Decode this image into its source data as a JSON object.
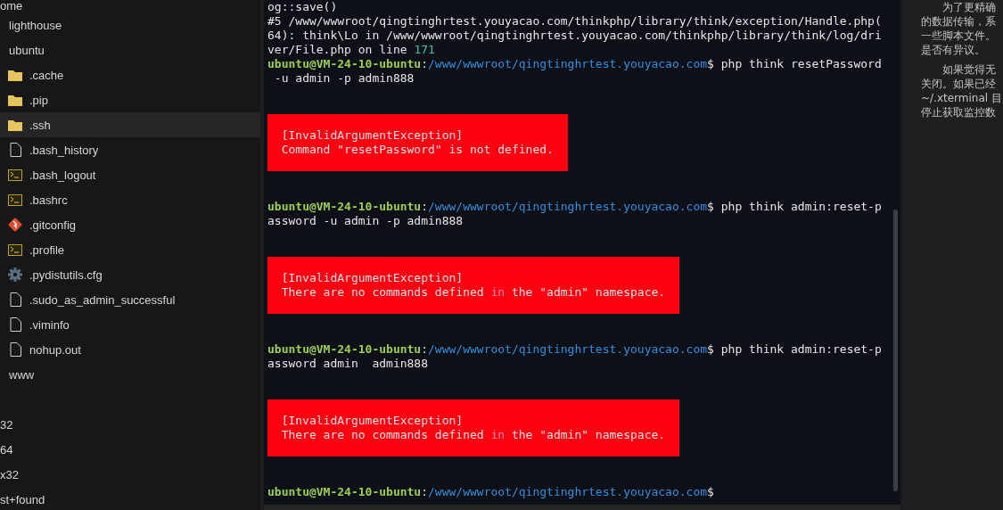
{
  "file_tree": [
    {
      "name": "ome",
      "selected": false,
      "children": [
        {
          "name": "lighthouse",
          "selected": false
        },
        {
          "name": "ubuntu",
          "selected": false,
          "children": [
            {
              "name": ".cache",
              "kind": "folder",
              "selected": false
            },
            {
              "name": ".pip",
              "kind": "folder",
              "selected": false
            },
            {
              "name": ".ssh",
              "kind": "folder",
              "selected": true
            },
            {
              "name": ".bash_history",
              "kind": "file",
              "selected": false
            },
            {
              "name": ".bash_logout",
              "kind": "terminal",
              "selected": false
            },
            {
              "name": ".bashrc",
              "kind": "terminal",
              "selected": false
            },
            {
              "name": ".gitconfig",
              "kind": "git",
              "selected": false
            },
            {
              "name": ".profile",
              "kind": "terminal",
              "selected": false
            },
            {
              "name": ".pydistutils.cfg",
              "kind": "gear",
              "selected": false
            },
            {
              "name": ".sudo_as_admin_successful",
              "kind": "file",
              "selected": false
            },
            {
              "name": ".viminfo",
              "kind": "file",
              "selected": false
            },
            {
              "name": "nohup.out",
              "kind": "file",
              "selected": false
            }
          ]
        },
        {
          "name": "www",
          "selected": false
        }
      ]
    },
    {
      "name": "32",
      "selected": false
    },
    {
      "name": "64",
      "selected": false
    },
    {
      "name": "x32",
      "selected": false
    },
    {
      "name": "st+found",
      "selected": false
    }
  ],
  "terminal": {
    "blocks": [
      {
        "kind": "output",
        "lines": [
          [
            {
              "text": "og::save()",
              "kind": "plain"
            }
          ],
          [
            {
              "text": "#5 /www/wwwroot/qingtinghrtest.youyacao.com/thinkphp/library/think/exception/Handle.php(",
              "kind": "plain"
            }
          ],
          [
            {
              "text": "64): think\\Lo in /www/wwwroot/qingtinghrtest.youyacao.com/thinkphp/library/think/log/dri",
              "kind": "plain"
            }
          ],
          [
            {
              "text": "ver/File.php on line ",
              "kind": "plain"
            },
            {
              "text": "171",
              "kind": "number"
            }
          ],
          [
            {
              "text": "ubuntu@VM-24-10-ubuntu",
              "kind": "user"
            },
            {
              "text": ":",
              "kind": "plain"
            },
            {
              "text": "/www/wwwroot/qingtinghrtest.youyacao.com",
              "kind": "path"
            },
            {
              "text": "$ php think resetPassword",
              "kind": "plain"
            }
          ],
          [
            {
              "text": " -u admin -p admin888",
              "kind": "plain"
            }
          ]
        ]
      },
      {
        "kind": "error",
        "lines": [
          [
            {
              "text": "[InvalidArgumentException]",
              "kind": "plain"
            }
          ],
          [
            {
              "text": "Command \"resetPassword\" is not defined.",
              "kind": "plain"
            }
          ]
        ]
      },
      {
        "kind": "output",
        "lines": [
          [
            {
              "text": "ubuntu@VM-24-10-ubuntu",
              "kind": "user"
            },
            {
              "text": ":",
              "kind": "plain"
            },
            {
              "text": "/www/wwwroot/qingtinghrtest.youyacao.com",
              "kind": "path"
            },
            {
              "text": "$ php think admin:reset-p",
              "kind": "plain"
            }
          ],
          [
            {
              "text": "assword -u admin -p admin888",
              "kind": "plain"
            }
          ]
        ]
      },
      {
        "kind": "error",
        "lines": [
          [
            {
              "text": "[InvalidArgumentException]",
              "kind": "plain"
            }
          ],
          [
            {
              "text": "There are no commands defined ",
              "kind": "plain"
            },
            {
              "text": "in",
              "kind": "keyword"
            },
            {
              "text": " the \"admin\" namespace.",
              "kind": "plain"
            }
          ]
        ]
      },
      {
        "kind": "output",
        "lines": [
          [
            {
              "text": "ubuntu@VM-24-10-ubuntu",
              "kind": "user"
            },
            {
              "text": ":",
              "kind": "plain"
            },
            {
              "text": "/www/wwwroot/qingtinghrtest.youyacao.com",
              "kind": "path"
            },
            {
              "text": "$ php think admin:reset-p",
              "kind": "plain"
            }
          ],
          [
            {
              "text": "assword admin  admin888",
              "kind": "plain"
            }
          ]
        ]
      },
      {
        "kind": "error",
        "lines": [
          [
            {
              "text": "[InvalidArgumentException]",
              "kind": "plain"
            }
          ],
          [
            {
              "text": "There are no commands defined ",
              "kind": "plain"
            },
            {
              "text": "in",
              "kind": "keyword"
            },
            {
              "text": " the \"admin\" namespace.",
              "kind": "plain"
            }
          ]
        ]
      },
      {
        "kind": "output",
        "lines": [
          [
            {
              "text": "ubuntu@VM-24-10-ubuntu",
              "kind": "user"
            },
            {
              "text": ":",
              "kind": "plain"
            },
            {
              "text": "/www/wwwroot/qingtinghrtest.youyacao.com",
              "kind": "path"
            },
            {
              "text": "$",
              "kind": "plain"
            }
          ]
        ]
      }
    ]
  },
  "side_note": {
    "paragraphs": [
      [
        "为了更精确",
        "的数据传输，系",
        "一些脚本文件。",
        "是否有异议。"
      ],
      [
        "如果觉得无",
        "关闭。如果已经",
        "~/.xterminal 目",
        "停止获取监控数"
      ]
    ]
  }
}
